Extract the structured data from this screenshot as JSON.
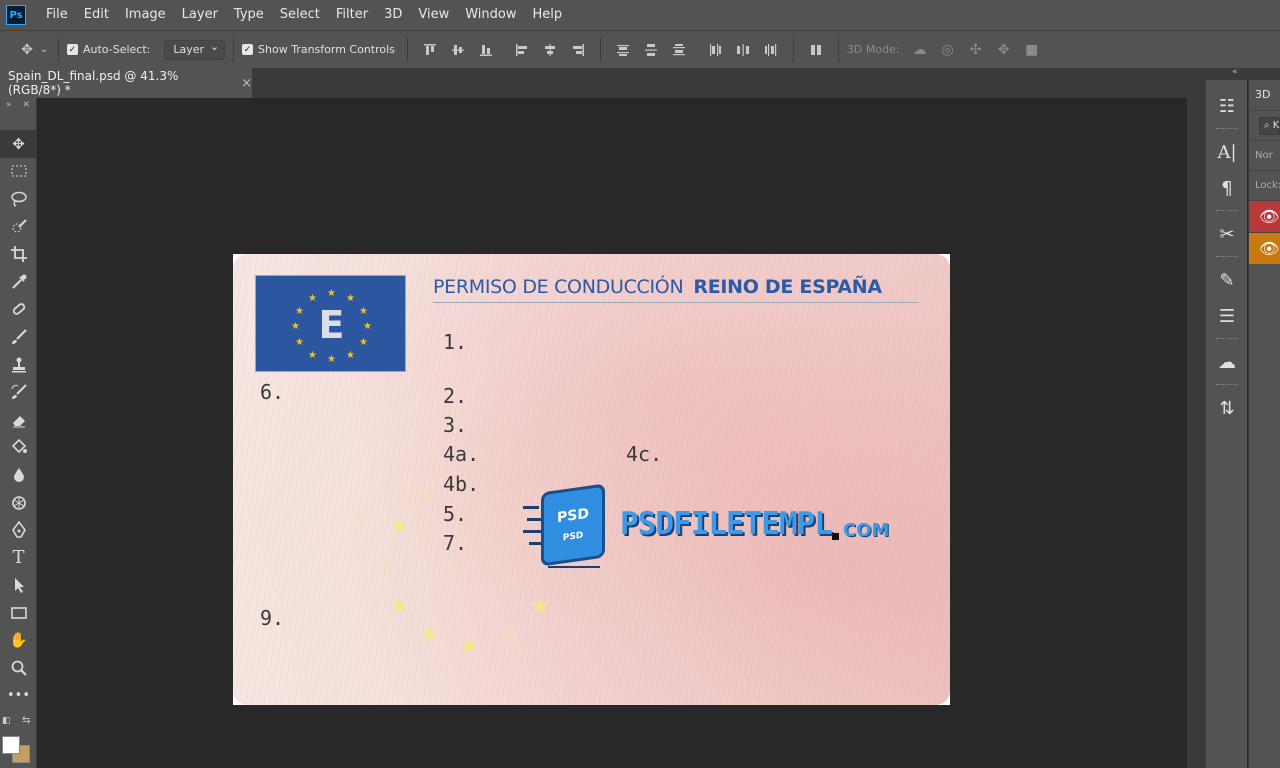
{
  "app": {
    "logo_text": "Ps"
  },
  "menu": [
    "File",
    "Edit",
    "Image",
    "Layer",
    "Type",
    "Select",
    "Filter",
    "3D",
    "View",
    "Window",
    "Help"
  ],
  "options": {
    "auto_select_label": "Auto-Select:",
    "auto_select_value": "Layer",
    "show_transform_label": "Show Transform Controls",
    "mode_3d_label": "3D Mode:"
  },
  "document_tab": {
    "title": "Spain_DL_final.psd @ 41.3% (RGB/8*) *",
    "close": "×"
  },
  "card": {
    "eu_letter": "E",
    "title_left": "PERMISO DE CONDUCCIÓN",
    "title_right": "REINO DE ESPAÑA",
    "fields": {
      "f1": "1.",
      "f2": "2.",
      "f3": "3.",
      "f4a": "4a.",
      "f4b": "4b.",
      "f4c": "4c.",
      "f5": "5.",
      "f6": "6.",
      "f7": "7.",
      "f9": "9."
    },
    "colors": {
      "eu_blue": "#2c56a0",
      "title_blue": "#2a5aa8",
      "star_gold": "#f2c318"
    }
  },
  "watermark": {
    "badge_top": "PSD",
    "badge_bottom": "PSD",
    "text": "PSDFILETEMPL",
    "suffix": "COM"
  },
  "panels": {
    "tab_3d": "3D",
    "search_placeholder": "K",
    "name_label": "Nor",
    "lock_label": "Lock:"
  }
}
